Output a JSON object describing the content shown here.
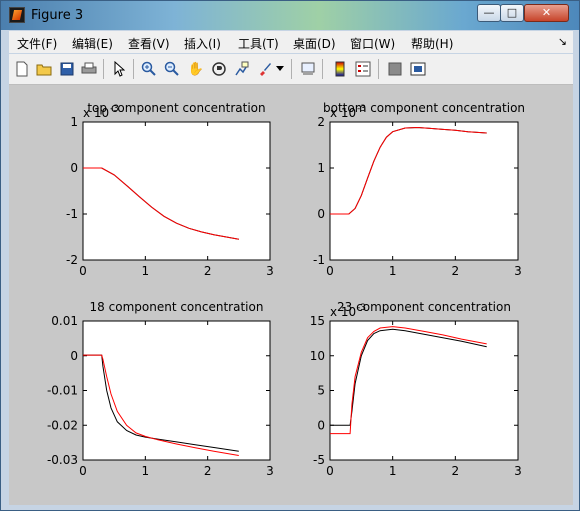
{
  "window": {
    "title": "Figure 3"
  },
  "menu": [
    "文件(F)",
    "编辑(E)",
    "查看(V)",
    "插入(I)",
    "工具(T)",
    "桌面(D)",
    "窗口(W)",
    "帮助(H)"
  ],
  "toolbar": [
    "new-figure-icon",
    "open-file-icon",
    "save-icon",
    "print-icon",
    "pointer-icon",
    "zoom-in-icon",
    "zoom-out-icon",
    "pan-hand-icon",
    "rotate-3d-icon",
    "data-cursor-icon",
    "brush-icon",
    "brush-dropdown-icon",
    "link-plot-icon",
    "colorbar-icon",
    "legend-icon",
    "hide-plot-tools-icon",
    "show-plot-tools-icon"
  ],
  "colors": {
    "series1": "#000000",
    "series2": "#ff0000",
    "figure_bg": "#c8c8c8"
  },
  "chart_data": [
    {
      "type": "line",
      "title": "top component concentration",
      "exponent": "x 10",
      "exponent_power": "-3",
      "xlim": [
        0,
        3
      ],
      "ylim": [
        -2,
        1
      ],
      "xticks": [
        "0",
        "1",
        "2",
        "3"
      ],
      "yticks": [
        "-2",
        "-1",
        "0",
        "1"
      ],
      "series": [
        {
          "color": "#000000",
          "x": [
            0,
            0.3,
            0.5,
            0.7,
            0.9,
            1.1,
            1.3,
            1.5,
            1.7,
            1.9,
            2.1,
            2.3,
            2.5
          ],
          "y": [
            0,
            0,
            -0.15,
            -0.38,
            -0.62,
            -0.85,
            -1.05,
            -1.2,
            -1.31,
            -1.39,
            -1.45,
            -1.5,
            -1.55
          ]
        },
        {
          "color": "#ff0000",
          "x": [
            0,
            0.3,
            0.5,
            0.7,
            0.9,
            1.1,
            1.3,
            1.5,
            1.7,
            1.9,
            2.1,
            2.3,
            2.5
          ],
          "y": [
            0,
            0,
            -0.15,
            -0.38,
            -0.62,
            -0.85,
            -1.05,
            -1.2,
            -1.31,
            -1.39,
            -1.45,
            -1.5,
            -1.55
          ]
        }
      ]
    },
    {
      "type": "line",
      "title": "bottom component concentration",
      "exponent": "x 10",
      "exponent_power": "-3",
      "xlim": [
        0,
        3
      ],
      "ylim": [
        -1,
        2
      ],
      "xticks": [
        "0",
        "1",
        "2",
        "3"
      ],
      "yticks": [
        "-1",
        "0",
        "1",
        "2"
      ],
      "series": [
        {
          "color": "#000000",
          "x": [
            0,
            0.3,
            0.4,
            0.5,
            0.6,
            0.7,
            0.8,
            0.9,
            1.0,
            1.2,
            1.4,
            1.6,
            1.8,
            2.0,
            2.2,
            2.5
          ],
          "y": [
            0,
            0,
            0.12,
            0.4,
            0.78,
            1.15,
            1.45,
            1.67,
            1.79,
            1.87,
            1.88,
            1.86,
            1.84,
            1.82,
            1.79,
            1.76
          ]
        },
        {
          "color": "#ff0000",
          "x": [
            0,
            0.3,
            0.4,
            0.5,
            0.6,
            0.7,
            0.8,
            0.9,
            1.0,
            1.2,
            1.4,
            1.6,
            1.8,
            2.0,
            2.2,
            2.5
          ],
          "y": [
            0,
            0,
            0.12,
            0.4,
            0.78,
            1.15,
            1.45,
            1.67,
            1.79,
            1.87,
            1.88,
            1.86,
            1.84,
            1.82,
            1.79,
            1.76
          ]
        }
      ]
    },
    {
      "type": "line",
      "title": "18 component concentration",
      "xlim": [
        0,
        3
      ],
      "ylim": [
        -0.03,
        0.01
      ],
      "xticks": [
        "0",
        "1",
        "2",
        "3"
      ],
      "yticks": [
        "-0.03",
        "-0.02",
        "-0.01",
        "0",
        "0.01"
      ],
      "series": [
        {
          "color": "#000000",
          "x": [
            0,
            0.3,
            0.32,
            0.38,
            0.45,
            0.55,
            0.7,
            0.85,
            1.0,
            1.2,
            1.5,
            1.8,
            2.1,
            2.5
          ],
          "y": [
            0.0002,
            0.0002,
            -0.003,
            -0.01,
            -0.015,
            -0.019,
            -0.0215,
            -0.0228,
            -0.0234,
            -0.024,
            -0.0248,
            -0.0256,
            -0.0264,
            -0.0275
          ]
        },
        {
          "color": "#ff0000",
          "x": [
            0,
            0.3,
            0.32,
            0.38,
            0.45,
            0.55,
            0.7,
            0.85,
            1.0,
            1.2,
            1.5,
            1.8,
            2.1,
            2.5
          ],
          "y": [
            0.0002,
            0.0002,
            -0.001,
            -0.006,
            -0.011,
            -0.016,
            -0.02,
            -0.0222,
            -0.0232,
            -0.0242,
            -0.0254,
            -0.0265,
            -0.0275,
            -0.0287
          ]
        }
      ]
    },
    {
      "type": "line",
      "title": "23 component concentration",
      "exponent": "x 10",
      "exponent_power": "-3",
      "xlim": [
        0,
        3
      ],
      "ylim": [
        -5,
        15
      ],
      "xticks": [
        "0",
        "1",
        "2",
        "3"
      ],
      "yticks": [
        "-5",
        "0",
        "5",
        "10",
        "15"
      ],
      "series": [
        {
          "color": "#000000",
          "x": [
            0,
            0.3,
            0.32,
            0.35,
            0.4,
            0.5,
            0.6,
            0.7,
            0.8,
            1.0,
            1.2,
            1.5,
            1.8,
            2.1,
            2.5
          ],
          "y": [
            0,
            0,
            0,
            2,
            6,
            10,
            12.2,
            13.2,
            13.6,
            13.8,
            13.6,
            13.1,
            12.6,
            12.1,
            11.3
          ]
        },
        {
          "color": "#ff0000",
          "x": [
            0,
            0.3,
            0.32,
            0.35,
            0.4,
            0.5,
            0.6,
            0.7,
            0.8,
            1.0,
            1.2,
            1.5,
            1.8,
            2.1,
            2.5
          ],
          "y": [
            -1.2,
            -1.2,
            -1.2,
            3,
            7,
            10.5,
            12.6,
            13.5,
            14.0,
            14.2,
            14.0,
            13.5,
            13.0,
            12.4,
            11.7
          ]
        }
      ]
    }
  ]
}
